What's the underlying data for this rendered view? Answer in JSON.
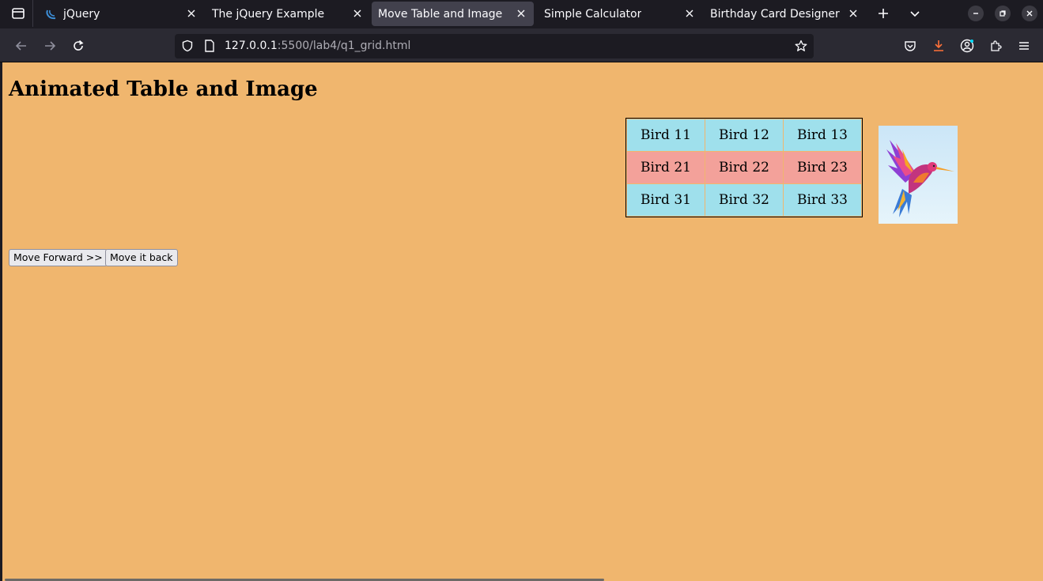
{
  "browser": {
    "tabs": [
      {
        "label": "jQuery",
        "favicon": "jquery-icon",
        "active": false
      },
      {
        "label": "The jQuery Example",
        "favicon": "",
        "active": false
      },
      {
        "label": "Move Table and Image",
        "favicon": "",
        "active": true
      },
      {
        "label": "Simple Calculator",
        "favicon": "",
        "active": false
      },
      {
        "label": "Birthday Card Designer",
        "favicon": "",
        "active": false
      }
    ],
    "url": {
      "host": "127.0.0.1",
      "path": ":5500/lab4/q1_grid.html"
    }
  },
  "page": {
    "title": "Animated Table and Image",
    "background": "#f0b66e",
    "table": {
      "rows": [
        {
          "cells": [
            "Bird 11",
            "Bird 12",
            "Bird 13"
          ],
          "color": "#9fe0ec"
        },
        {
          "cells": [
            "Bird 21",
            "Bird 22",
            "Bird 23"
          ],
          "color": "#f3a19a"
        },
        {
          "cells": [
            "Bird 31",
            "Bird 32",
            "Bird 33"
          ],
          "color": "#9fe0ec"
        }
      ]
    },
    "image": {
      "subject": "colorful hummingbird illustration",
      "icon": "hummingbird-image"
    },
    "buttons": {
      "forward": "Move Forward >>",
      "back": "Move it back"
    }
  }
}
